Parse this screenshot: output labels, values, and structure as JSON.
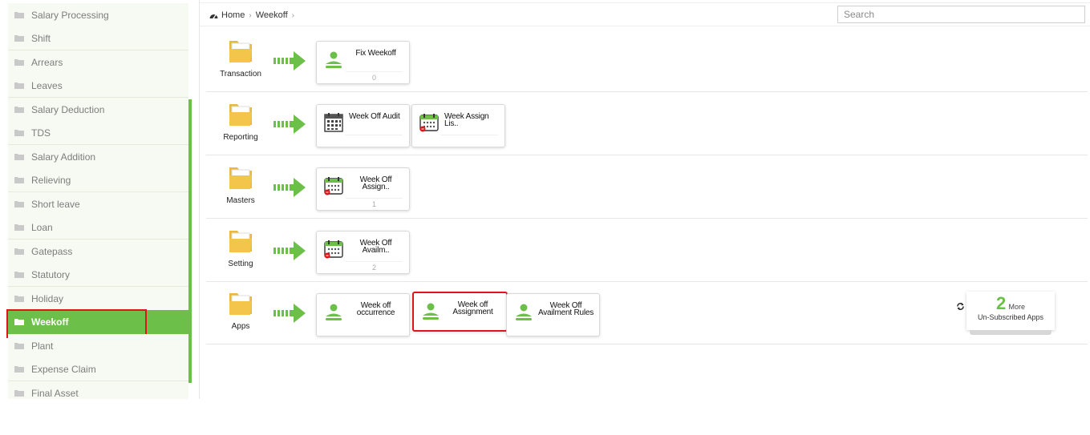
{
  "sidebar": {
    "items": [
      {
        "label": "Salary Processing"
      },
      {
        "label": "Shift"
      },
      {
        "label": "Arrears"
      },
      {
        "label": "Leaves"
      },
      {
        "label": "Salary Deduction"
      },
      {
        "label": "TDS"
      },
      {
        "label": "Salary Addition"
      },
      {
        "label": "Relieving"
      },
      {
        "label": "Short leave"
      },
      {
        "label": "Loan"
      },
      {
        "label": "Gatepass"
      },
      {
        "label": "Statutory"
      },
      {
        "label": "Holiday"
      },
      {
        "label": "Weekoff"
      },
      {
        "label": "Plant"
      },
      {
        "label": "Expense Claim"
      },
      {
        "label": "Final Asset"
      }
    ],
    "active_label": "Weekoff"
  },
  "breadcrumb": {
    "home": "Home",
    "current": "Weekoff"
  },
  "search": {
    "placeholder": "Search"
  },
  "rows": [
    {
      "label": "Transaction",
      "cards": [
        {
          "title": "Fix Weekoff",
          "count": "0",
          "icon": "user-icon"
        }
      ]
    },
    {
      "label": "Reporting",
      "cards": [
        {
          "title": "Week Off Audit",
          "icon": "calendar-grid-icon"
        },
        {
          "title": "Week Assign Lis..",
          "icon": "calendar-icon"
        }
      ]
    },
    {
      "label": "Masters",
      "cards": [
        {
          "title_line1": "Week Off",
          "title_line2": "Assign..",
          "count": "1",
          "icon": "calendar-icon"
        }
      ]
    },
    {
      "label": "Setting",
      "cards": [
        {
          "title_line1": "Week Off",
          "title_line2": "Availm..",
          "count": "2",
          "icon": "calendar-icon"
        }
      ]
    },
    {
      "label": "Apps",
      "cards": [
        {
          "title_line1": "Week off",
          "title_line2": "occurrence",
          "icon": "user-icon"
        },
        {
          "title_line1": "Week off",
          "title_line2": "Assignment",
          "icon": "user-icon"
        },
        {
          "title_line1": "Week Off",
          "title_line2": "Availment Rules",
          "icon": "user-icon"
        }
      ]
    }
  ],
  "more_apps": {
    "count": "2",
    "more_label": "More",
    "sub_label": "Un-Subscribed Apps"
  },
  "colors": {
    "accent": "#6cc04a",
    "highlight": "#e0151b",
    "folder": "#f3c64b"
  }
}
